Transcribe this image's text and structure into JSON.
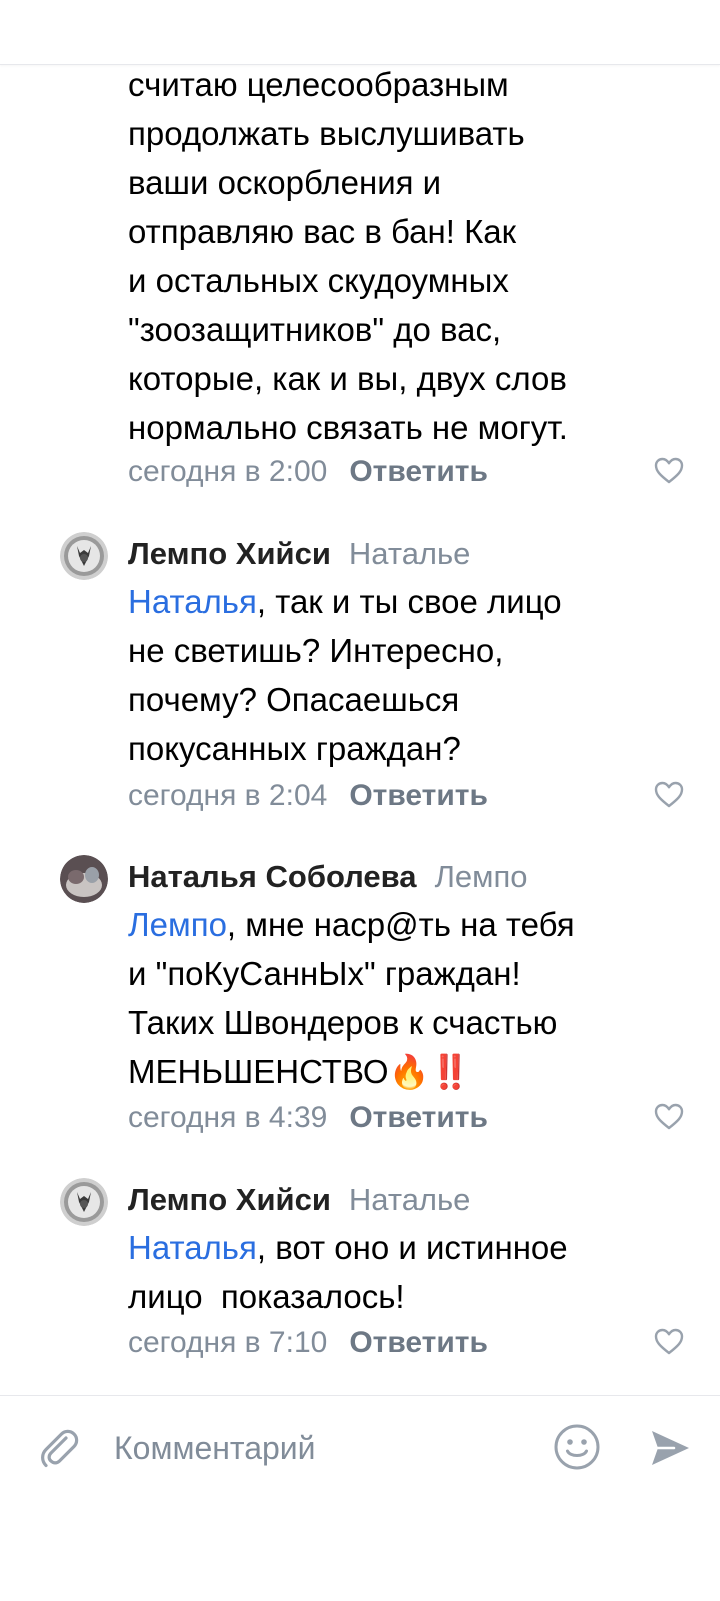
{
  "comments": [
    {
      "text": "считаю целесообразным\nпродолжать выслушивать\nваши оскорбления и\nотправляю вас в бан! Как\nи остальных скудоумных\n\"зоозащитников\" до вас,\nкоторые, как и вы, двух слов\nнормально связать не могут.",
      "time": "сегодня в 2:00",
      "reply_label": "Ответить"
    },
    {
      "author": "Лемпо Хийси",
      "reply_to": "Наталье",
      "mention": "Наталья",
      "text": ", так и ты свое лицо\nне светишь? Интересно,\nпочему? Опасаешься\nпокусанных граждан?",
      "time": "сегодня в 2:04",
      "reply_label": "Ответить"
    },
    {
      "author": "Наталья Соболева",
      "reply_to": "Лемпо",
      "mention": "Лемпо",
      "text": ", мне наср@ть на тебя\nи \"поКуСаннЫх\" граждан!\nТаких Швондеров к счастью\nМЕНЬШЕНСТВО",
      "emoji": "🔥‼️",
      "time": "сегодня в 4:39",
      "reply_label": "Ответить"
    },
    {
      "author": "Лемпо Хийси",
      "reply_to": "Наталье",
      "mention": "Наталья",
      "text": ", вот оно и истинное\nлицо  показалось!",
      "time": "сегодня в 7:10",
      "reply_label": "Ответить"
    }
  ],
  "composer": {
    "placeholder": "Комментарий"
  },
  "icons": {
    "like": "heart-outline-icon",
    "attach": "paperclip-icon",
    "emoji": "smile-icon",
    "send": "send-arrow-icon"
  },
  "colors": {
    "mention": "#2a6ee0",
    "meta": "#818c99",
    "icon": "#99a2ad"
  }
}
